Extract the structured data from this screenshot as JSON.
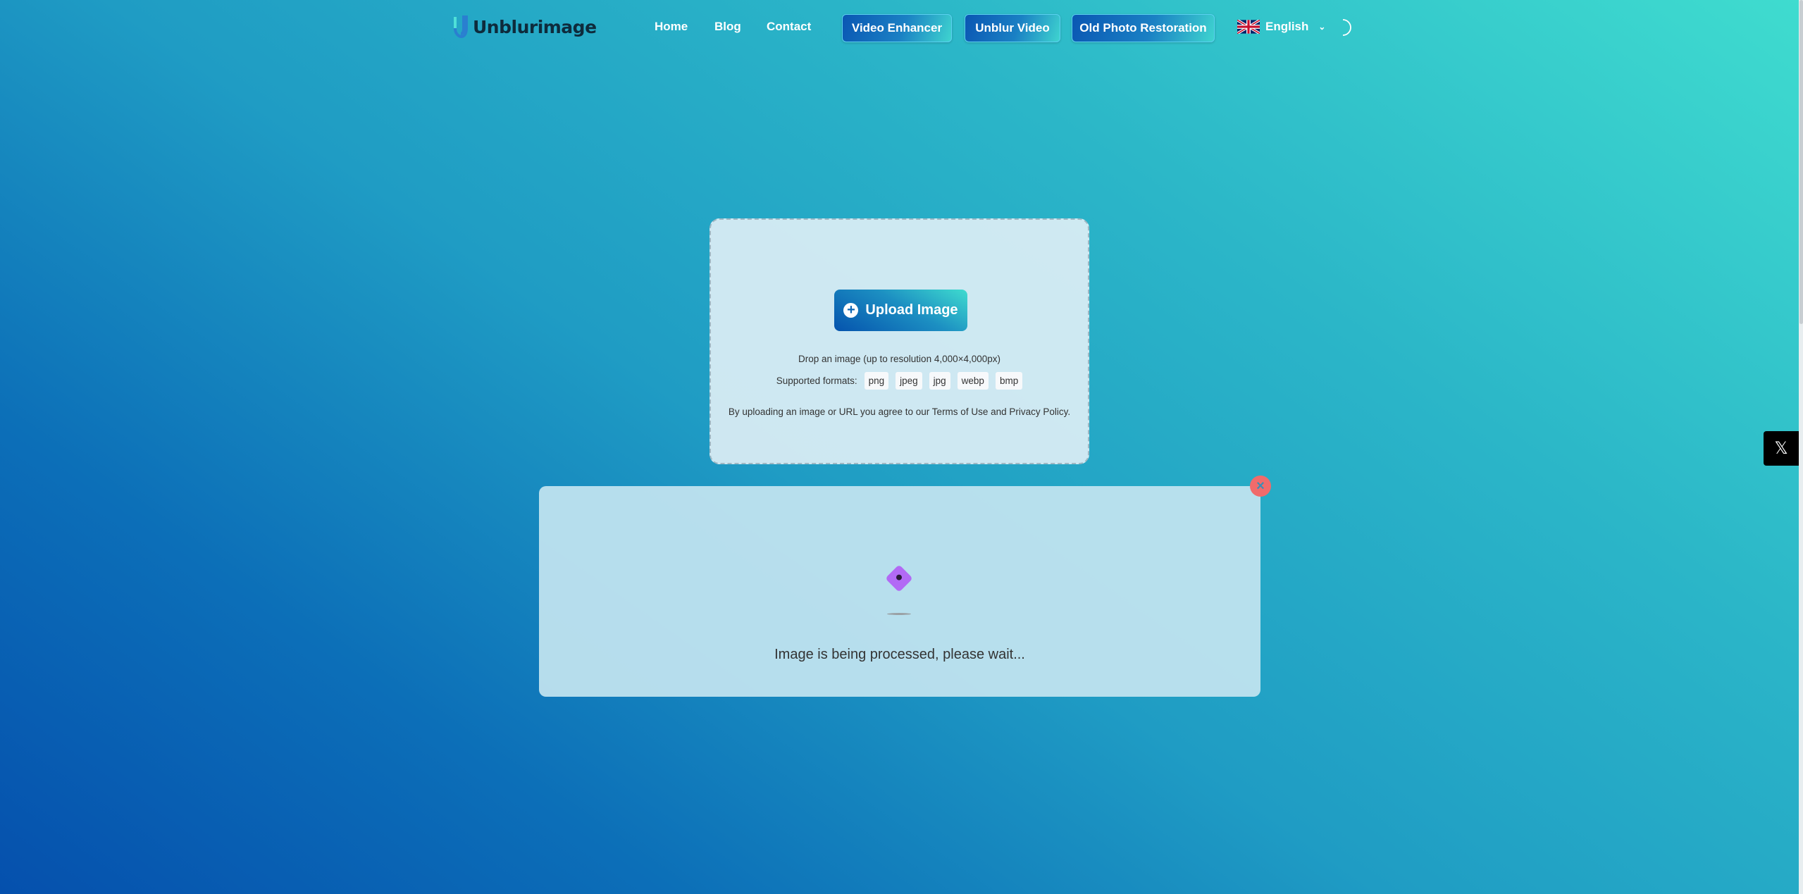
{
  "header": {
    "logo_text": "Unblurimage",
    "nav": [
      {
        "label": "Home"
      },
      {
        "label": "Blog"
      },
      {
        "label": "Contact"
      }
    ],
    "buttons": [
      {
        "label": "Video Enhancer"
      },
      {
        "label": "Unblur Video"
      },
      {
        "label": "Old Photo Restoration"
      }
    ],
    "language": "English",
    "language_icon": "uk-flag-icon",
    "theme_icon": "moon-icon"
  },
  "upload": {
    "button_label": "Upload Image",
    "drop_text": "Drop an image (up to resolution 4,000×4,000px)",
    "formats_label": "Supported formats:",
    "formats": [
      "png",
      "jpeg",
      "jpg",
      "webp",
      "bmp"
    ],
    "terms": "By uploading an image or URL you agree to our Terms of Use and Privacy Policy."
  },
  "processing": {
    "message": "Image is being processed, please wait...",
    "close_icon": "close-icon"
  },
  "social": {
    "icon": "x-twitter-icon"
  },
  "colors": {
    "accent": "#0a56b3",
    "teal": "#3fdccf",
    "close": "#f06b6b",
    "loader": "#b26af5"
  }
}
